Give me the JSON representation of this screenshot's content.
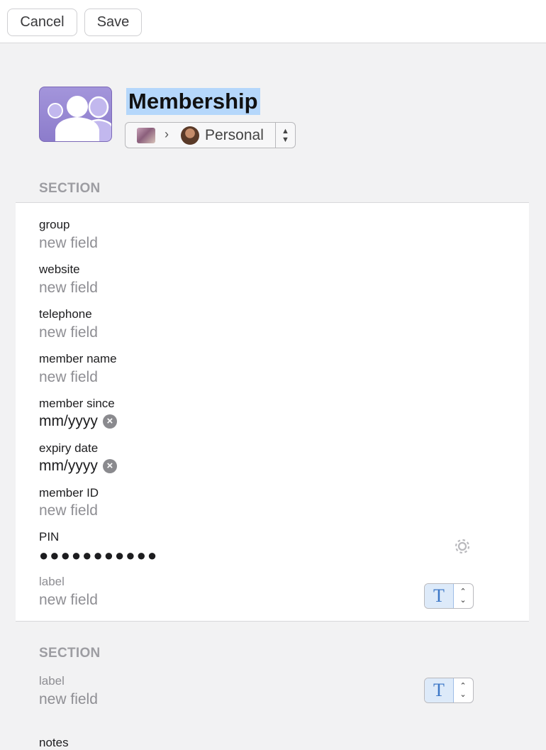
{
  "toolbar": {
    "cancel_label": "Cancel",
    "save_label": "Save"
  },
  "item": {
    "title": "Membership",
    "icon": "membership-people-icon"
  },
  "vault": {
    "name": "Personal"
  },
  "section1": {
    "header": "SECTION",
    "fields": [
      {
        "label": "group",
        "value": "new field"
      },
      {
        "label": "website",
        "value": "new field"
      },
      {
        "label": "telephone",
        "value": "new field"
      },
      {
        "label": "member name",
        "value": "new field"
      },
      {
        "label": "member since",
        "value": "mm/yyyy"
      },
      {
        "label": "expiry date",
        "value": "mm/yyyy"
      },
      {
        "label": "member ID",
        "value": "new field"
      },
      {
        "label": "PIN",
        "value": "●●●●●●●●●●●"
      },
      {
        "label": "label",
        "value": "new field"
      }
    ]
  },
  "section2": {
    "header": "SECTION",
    "field": {
      "label": "label",
      "value": "new field"
    },
    "notes_label": "notes"
  },
  "type_picker": {
    "glyph": "T",
    "up": "⌃",
    "down": "⌄"
  },
  "colors": {
    "accent": "#3b76c6",
    "selection": "#b5d7fb",
    "icon_bg": "#9486d2"
  }
}
